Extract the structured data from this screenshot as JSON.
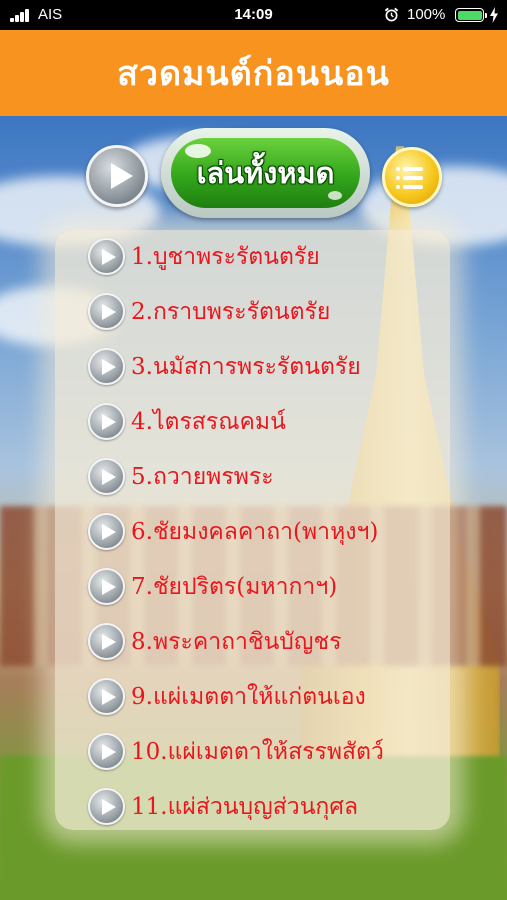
{
  "status_bar": {
    "carrier": "AIS",
    "time": "14:09",
    "battery": "100%"
  },
  "header": {
    "title": "สวดมนต์ก่อนนอน"
  },
  "controls": {
    "play_all_label": "เล่นทั้งหมด"
  },
  "menu": {
    "items": [
      {
        "label": "1.บูชาพระรัตนตรัย"
      },
      {
        "label": "2.กราบพระรัตนตรัย"
      },
      {
        "label": "3.นมัสการพระรัตนตรัย"
      },
      {
        "label": "4.ไตรสรณคมน์"
      },
      {
        "label": "5.ถวายพรพระ"
      },
      {
        "label": "6.ชัยมงคลคาถา(พาหุงฯ)"
      },
      {
        "label": "7.ชัยปริตร(มหากาฯ)"
      },
      {
        "label": "8.พระคาถาชินบัญชร"
      },
      {
        "label": "9.แผ่เมตตาให้แก่ตนเอง"
      },
      {
        "label": "10.แผ่เมตตาให้สรรพสัตว์"
      },
      {
        "label": "11.แผ่ส่วนบุญส่วนกุศล"
      }
    ]
  },
  "colors": {
    "header": "#f7931e",
    "item_text": "#e8171e",
    "button_green": "#33a61b",
    "battery_green": "#4cd964"
  }
}
